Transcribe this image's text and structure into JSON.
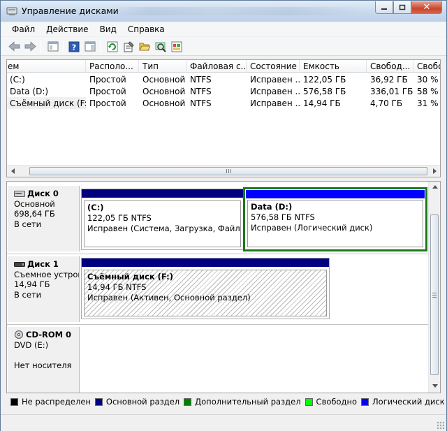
{
  "window": {
    "title": "Управление дисками",
    "buttons": {
      "minimize": "–",
      "maximize": "□",
      "close": "✕"
    }
  },
  "menu": {
    "items": [
      "Файл",
      "Действие",
      "Вид",
      "Справка"
    ]
  },
  "toolbar": {
    "icons": [
      "back-arrow-icon",
      "forward-arrow-icon",
      "show-hide-console-tree-icon",
      "help-icon",
      "action-pane-icon",
      "refresh-icon",
      "properties-icon",
      "open-folder-icon",
      "search-disk-icon",
      "export-list-icon"
    ]
  },
  "volume_list": {
    "columns": [
      "Том",
      "Располо...",
      "Тип",
      "Файловая с...",
      "Состояние",
      "Емкость",
      "Свобод...",
      "Свобо"
    ],
    "columns_visible": [
      "ем",
      "Располо...",
      "Тип",
      "Файловая с...",
      "Состояние",
      "Емкость",
      "Свобод...",
      "Свобо"
    ],
    "rows": [
      [
        "(C:)",
        "Простой",
        "Основной",
        "NTFS",
        "Исправен ...",
        "122,05 ГБ",
        "36,92 ГБ",
        "30 %"
      ],
      [
        "Data (D:)",
        "Простой",
        "Основной",
        "NTFS",
        "Исправен ...",
        "576,58 ГБ",
        "336,01 ГБ",
        "58 %"
      ],
      [
        "Съёмный диск (F:)",
        "Простой",
        "Основной",
        "NTFS",
        "Исправен ...",
        "14,94 ГБ",
        "4,70 ГБ",
        "31 %"
      ]
    ],
    "scroll_grip": "|||"
  },
  "disks": [
    {
      "name": "Диск 0",
      "type": "Основной",
      "size": "698,64 ГБ",
      "status": "В сети",
      "partitions": [
        {
          "name": "(C:)",
          "size_fs": "122,05 ГБ NTFS",
          "status": "Исправен (Система, Загрузка, Файл подкачки, Аварийный дамп, Основной раздел)",
          "bar_color": "#000080"
        },
        {
          "name": "Data  (D:)",
          "size_fs": "576,58 ГБ NTFS",
          "status": "Исправен (Логический диск)",
          "bar_color": "#0000ff"
        }
      ]
    },
    {
      "name": "Диск 1",
      "type": "Съемное устройство",
      "size": "14,94 ГБ",
      "status": "В сети",
      "partitions": [
        {
          "name": "Съёмный диск  (F:)",
          "size_fs": "14,94 ГБ NTFS",
          "status": "Исправен (Активен, Основной раздел)",
          "bar_color": "#000080"
        }
      ]
    },
    {
      "name": "CD-ROM 0",
      "type": "DVD (E:)",
      "size": "",
      "status": "Нет носителя"
    }
  ],
  "legend": [
    {
      "label": "Не распределен",
      "color": "#000000"
    },
    {
      "label": "Основной раздел",
      "color": "#000080"
    },
    {
      "label": "Дополнительный раздел",
      "color": "#008000"
    },
    {
      "label": "Свободно",
      "color": "#00ff00"
    },
    {
      "label": "Логический диск",
      "color": "#0000ff"
    }
  ]
}
